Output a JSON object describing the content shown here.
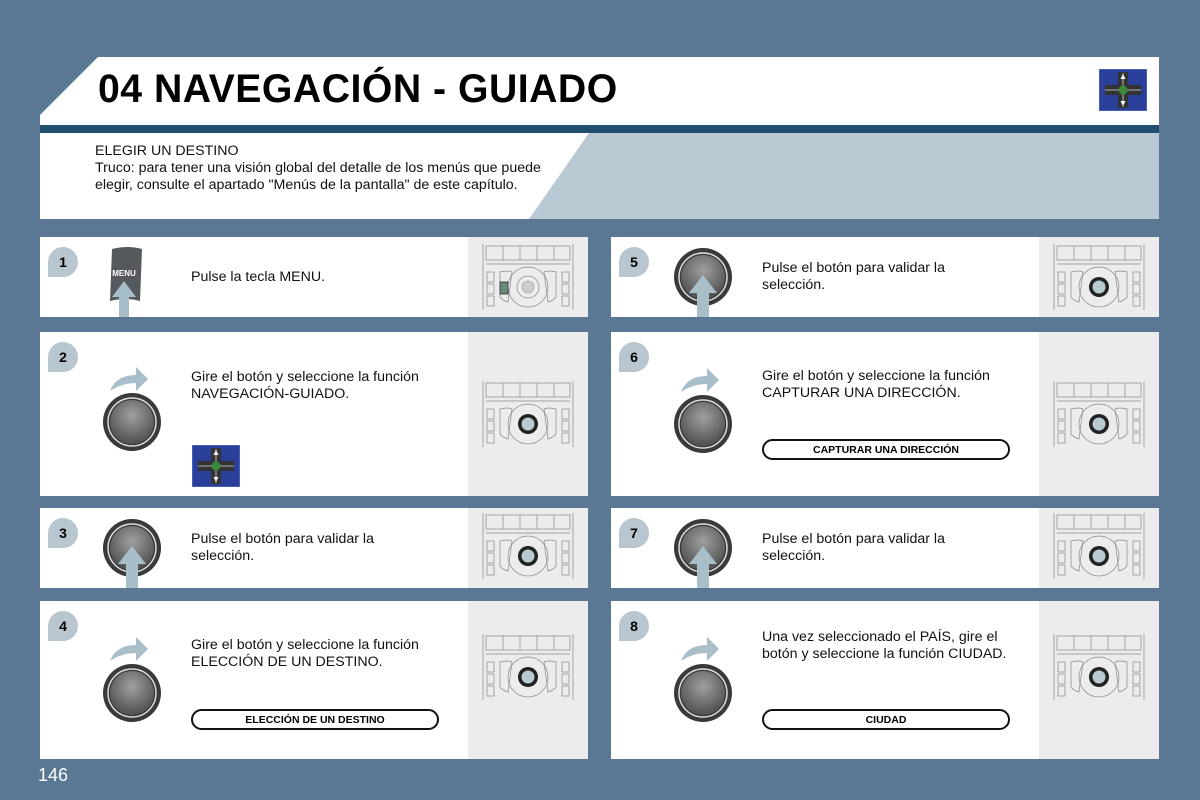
{
  "header": {
    "title": "04 NAVEGACIÓN - GUIADO",
    "icon": "navigation-crossroad-icon"
  },
  "intro": {
    "heading": "ELEGIR UN DESTINO",
    "tip": "Truco: para tener una visión global del detalle de los menús que puede elegir, consulte el apartado \"Menús de la pantalla\" de este capítulo."
  },
  "steps": [
    {
      "number": "1",
      "text": "Pulse la tecla MENU.",
      "visual": "menu-key",
      "key_label": "MENU"
    },
    {
      "number": "2",
      "text": "Gire el botón y seleccione la función NAVEGACIÓN-GUIADO.",
      "visual": "rotate-knob",
      "icon": "navigation-crossroad-icon"
    },
    {
      "number": "3",
      "text": "Pulse el botón para validar la selección.",
      "visual": "press-knob"
    },
    {
      "number": "4",
      "text": "Gire el botón y seleccione la función ELECCIÓN DE UN DESTINO.",
      "visual": "rotate-knob",
      "menu_item": "ELECCIÓN DE UN DESTINO"
    },
    {
      "number": "5",
      "text": "Pulse el botón para validar la selección.",
      "visual": "press-knob"
    },
    {
      "number": "6",
      "text": "Gire el botón y seleccione la función CAPTURAR UNA DIRECCIÓN.",
      "visual": "rotate-knob",
      "menu_item": "CAPTURAR UNA DIRECCIÓN"
    },
    {
      "number": "7",
      "text": "Pulse el botón para validar la selección.",
      "visual": "press-knob"
    },
    {
      "number": "8",
      "text": "Una vez seleccionado el PAÍS, gire el botón y seleccione la función CIUDAD.",
      "visual": "rotate-knob",
      "menu_item": "CIUDAD"
    }
  ],
  "page_number": "146"
}
